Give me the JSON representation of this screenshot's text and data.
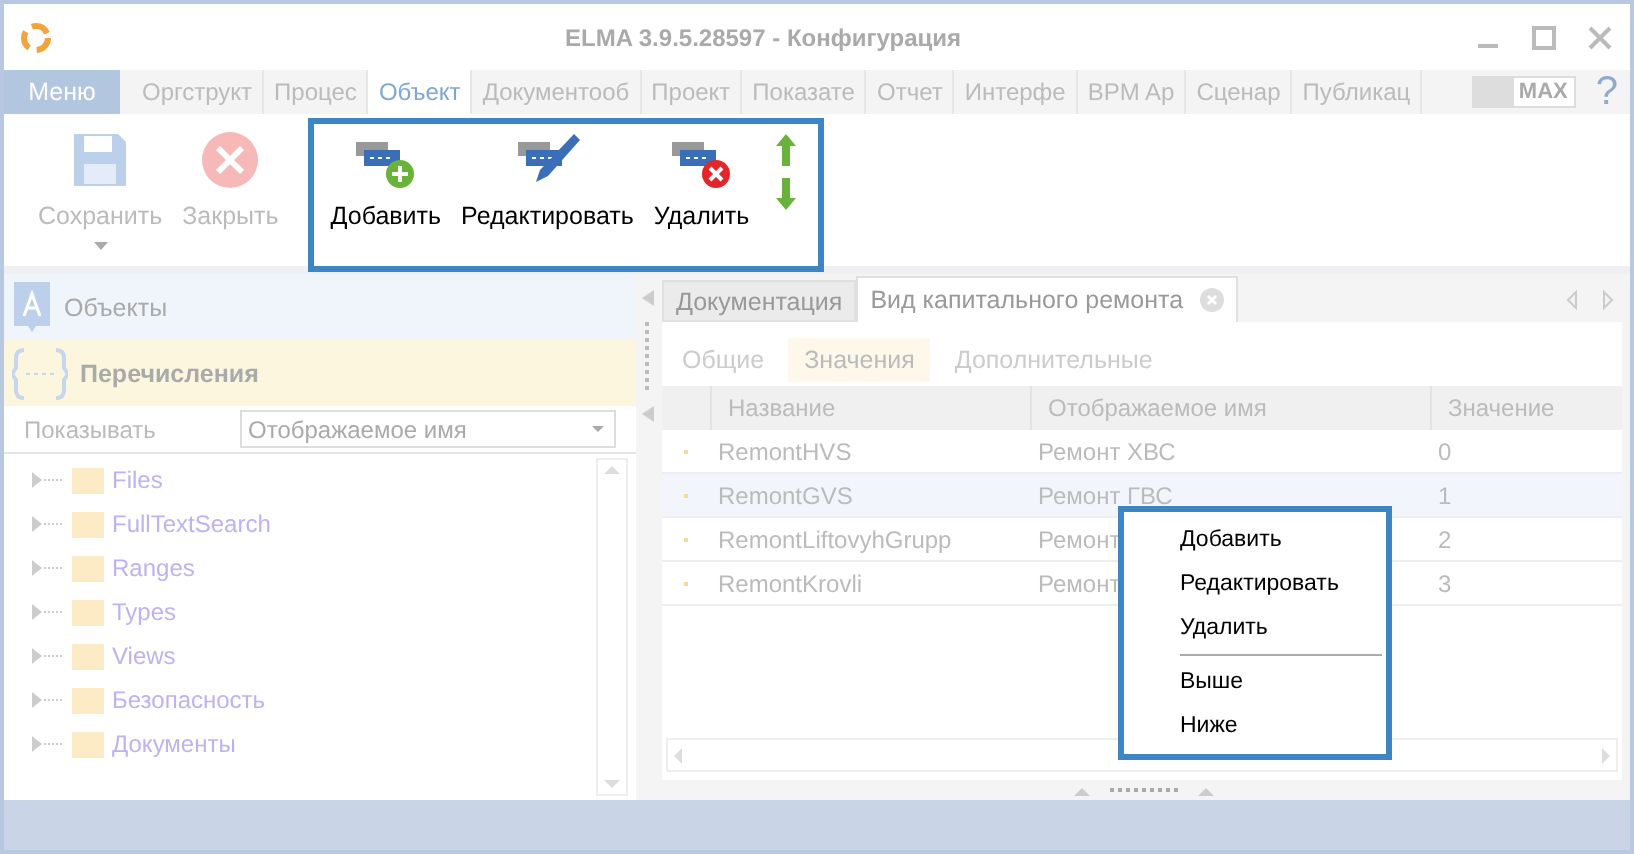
{
  "window": {
    "title": "ELMA 3.9.5.28597 - Конфигурация"
  },
  "menu_button": "Меню",
  "ribbon_tabs": [
    {
      "label": "Оргструкт",
      "selected": false
    },
    {
      "label": "Процес",
      "selected": false
    },
    {
      "label": "Объект",
      "selected": true
    },
    {
      "label": "Документооб",
      "selected": false
    },
    {
      "label": "Проект",
      "selected": false
    },
    {
      "label": "Показате",
      "selected": false
    },
    {
      "label": "Отчет",
      "selected": false
    },
    {
      "label": "Интерфе",
      "selected": false
    },
    {
      "label": "BPM Ap",
      "selected": false
    },
    {
      "label": "Сценар",
      "selected": false
    },
    {
      "label": "Публикац",
      "selected": false
    }
  ],
  "max_toggle": "MAX",
  "help": "?",
  "toolbar": {
    "groups": [
      {
        "highlighted": false,
        "buttons": [
          {
            "kind": "save",
            "label": "Сохранить",
            "disabled": true
          },
          {
            "kind": "close",
            "label": "Закрыть",
            "disabled": true
          }
        ]
      },
      {
        "highlighted": true,
        "buttons": [
          {
            "kind": "add",
            "label": "Добавить",
            "disabled": false
          },
          {
            "kind": "edit",
            "label": "Редактировать",
            "disabled": false
          },
          {
            "kind": "delete",
            "label": "Удалить",
            "disabled": false
          },
          {
            "kind": "updown"
          }
        ]
      }
    ]
  },
  "nav": [
    {
      "kind": "objects",
      "label": "Объекты",
      "selected": false
    },
    {
      "kind": "enums",
      "label": "Перечисления",
      "selected": true
    }
  ],
  "filter": {
    "label": "Показывать",
    "value": "Отображаемое имя"
  },
  "tree": [
    {
      "label": "Files"
    },
    {
      "label": "FullTextSearch"
    },
    {
      "label": "Ranges"
    },
    {
      "label": "Types"
    },
    {
      "label": "Views"
    },
    {
      "label": "Безопасность"
    },
    {
      "label": "Документы"
    }
  ],
  "doc_tabs": [
    {
      "label": "Документация",
      "selected": false,
      "closable": false
    },
    {
      "label": "Вид капитального ремонта",
      "selected": true,
      "closable": true
    }
  ],
  "sub_tabs": [
    {
      "label": "Общие",
      "selected": false
    },
    {
      "label": "Значения",
      "selected": true
    },
    {
      "label": "Дополнительные",
      "selected": false
    }
  ],
  "table": {
    "columns": [
      "Название",
      "Отображаемое имя",
      "Значение"
    ],
    "rows": [
      {
        "cells": [
          "RemontHVS",
          "Ремонт ХВС",
          "0"
        ],
        "selected": false
      },
      {
        "cells": [
          "RemontGVS",
          "Ремонт ГВС",
          "1"
        ],
        "selected": true
      },
      {
        "cells": [
          "RemontLiftovyhGrupp",
          "Ремонт",
          "2"
        ],
        "selected": false
      },
      {
        "cells": [
          "RemontKrovli",
          "Ремонт",
          "3"
        ],
        "selected": false
      }
    ]
  },
  "context_menu": [
    {
      "kind": "item",
      "label": "Добавить"
    },
    {
      "kind": "item",
      "label": "Редактировать"
    },
    {
      "kind": "item",
      "label": "Удалить"
    },
    {
      "kind": "separator"
    },
    {
      "kind": "item",
      "label": "Выше"
    },
    {
      "kind": "item",
      "label": "Ниже"
    }
  ]
}
